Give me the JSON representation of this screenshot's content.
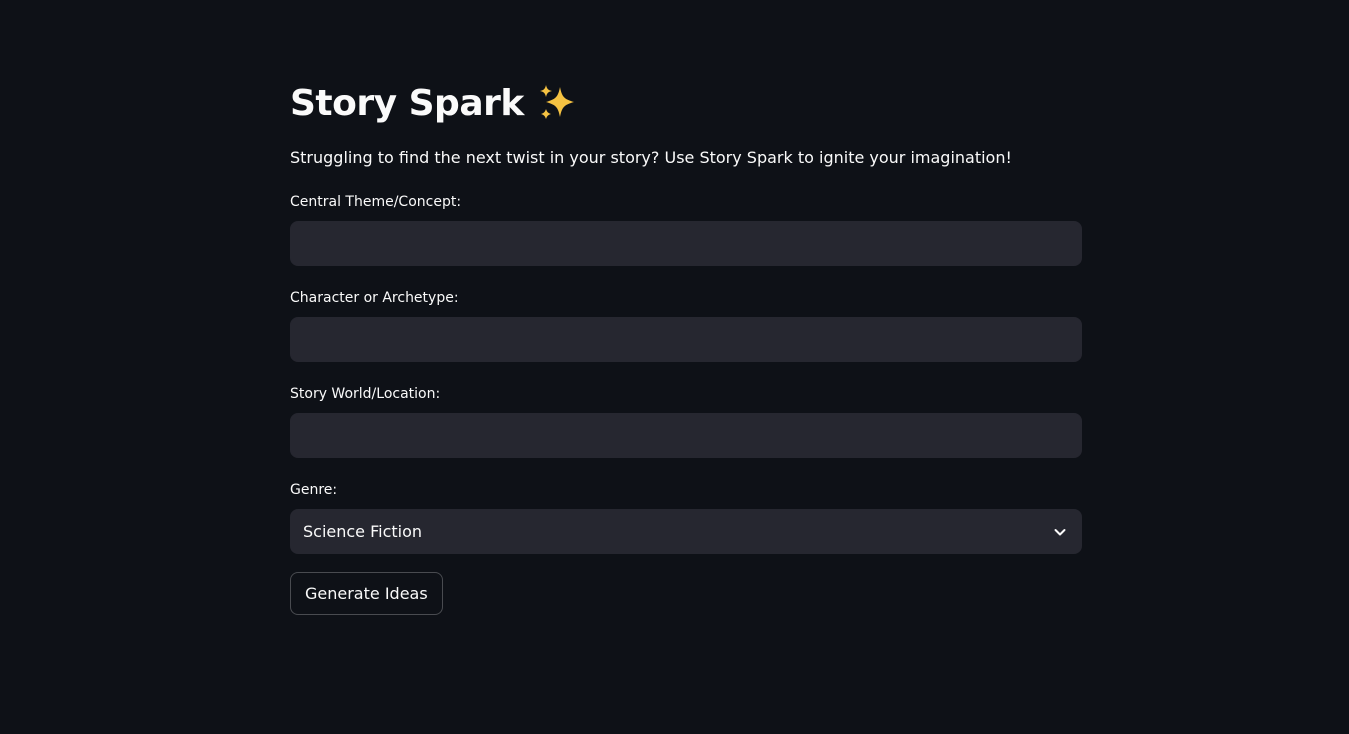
{
  "app": {
    "title": "Story Spark",
    "title_icon": "sparkles-icon",
    "subtitle": "Struggling to find the next twist in your story? Use Story Spark to ignite your imagination!"
  },
  "form": {
    "theme": {
      "label": "Central Theme/Concept:",
      "value": ""
    },
    "character": {
      "label": "Character or Archetype:",
      "value": ""
    },
    "world": {
      "label": "Story World/Location:",
      "value": ""
    },
    "genre": {
      "label": "Genre:",
      "selected": "Science Fiction",
      "icon": "chevron-down-icon"
    },
    "submit_label": "Generate Ideas"
  },
  "colors": {
    "background": "#0e1117",
    "input_background": "#262730",
    "text": "#fafafa",
    "sparkle": "#f5c242"
  }
}
